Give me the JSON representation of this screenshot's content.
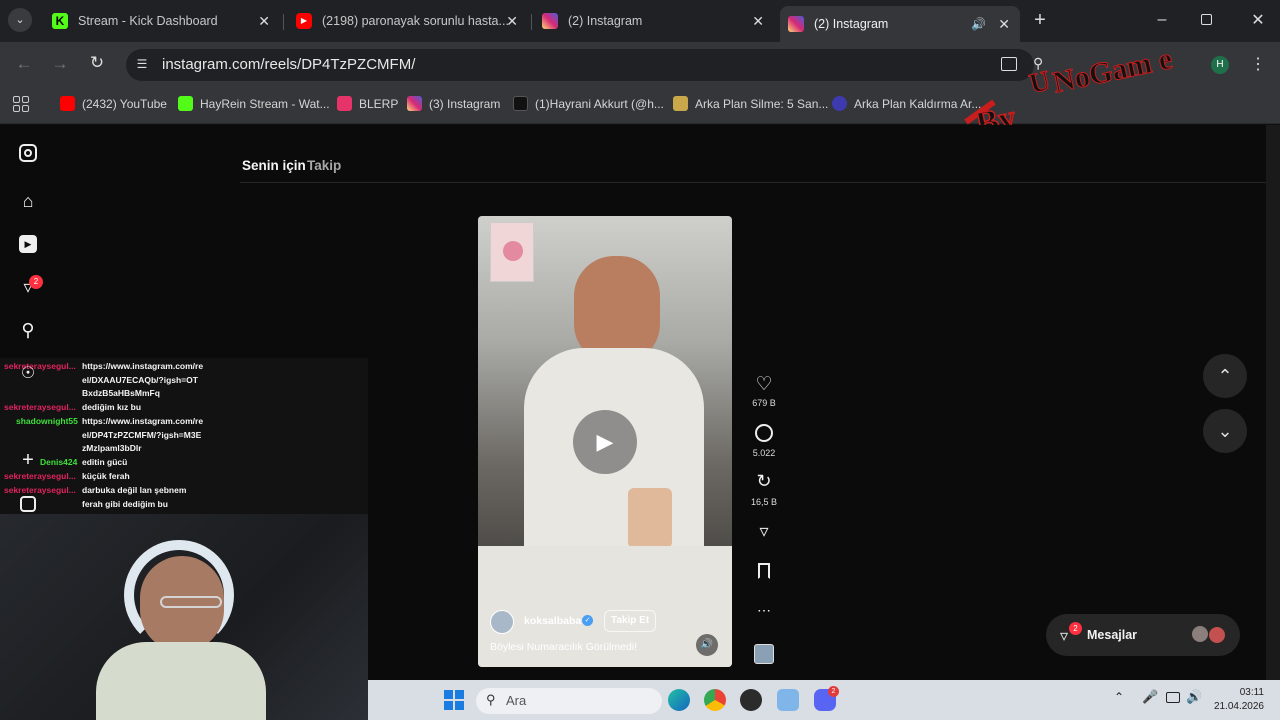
{
  "browser": {
    "tabs": [
      {
        "title": "Stream - Kick Dashboard",
        "favicon": "kick-icon",
        "color": "#53fc18"
      },
      {
        "title": "(2198) paronayak sorunlu hasta...",
        "favicon": "youtube-icon",
        "color": "#ff0000"
      },
      {
        "title": "(2) Instagram",
        "favicon": "instagram-icon",
        "color": "#d62976"
      },
      {
        "title": "(2) Instagram",
        "favicon": "instagram-icon",
        "color": "#d62976",
        "active": true
      }
    ],
    "url": "instagram.com/reels/DP4TzPZCMFM/",
    "profile_initial": "H",
    "bookmarks": [
      {
        "title": "(2432) YouTube",
        "favicon": "youtube-icon",
        "color": "#ff0000"
      },
      {
        "title": "HayRein Stream - Wat...",
        "favicon": "kick-icon",
        "color": "#53fc18"
      },
      {
        "title": "BLERP",
        "favicon": "blerp-icon",
        "color": "#e6346b"
      },
      {
        "title": "(3) Instagram",
        "favicon": "instagram-icon",
        "color": "#d62976"
      },
      {
        "title": "(1)Hayrani Akkurt (@h...",
        "favicon": "tiktok-icon",
        "color": "#111111"
      },
      {
        "title": "Arka Plan Silme: 5 San...",
        "favicon": "layers-icon",
        "color": "#c8a84a"
      },
      {
        "title": "Arka Plan Kaldırma Ar...",
        "favicon": "p-icon",
        "color": "#3d3ab0"
      }
    ]
  },
  "watermark": {
    "text_top": "NoGam e",
    "text_letter": "U",
    "text_by": "By"
  },
  "instagram": {
    "feed_tabs": [
      {
        "label": "Senin için",
        "active": true
      },
      {
        "label": "Takip",
        "active": false
      }
    ],
    "notification_badge": "2",
    "reel": {
      "username": "koksalbaba",
      "follow_label": "Takip Et",
      "caption": "Böylesi Numaracılık Görülmedi!",
      "likes": "679 B",
      "comments": "5.022",
      "reposts": "16,5 B"
    },
    "messages": {
      "label": "Mesajlar",
      "badge": "2"
    }
  },
  "chat": [
    {
      "user": "sekreteraysegul...",
      "user_color": "#e0235f",
      "msg": "https://www.instagram.com/reel/DXAAU7ECAQb/?igsh=OTBxdzB5aHBsMmFq"
    },
    {
      "user": "sekreteraysegul...",
      "user_color": "#e0235f",
      "msg": "dediğim kız bu"
    },
    {
      "user": "shadownight55",
      "user_color": "#3fe03c",
      "msg": "https://www.instagram.com/reel/DP4TzPZCMFM/?igsh=M3EzMzlpaml3bDlr"
    },
    {
      "user": "Denis424",
      "user_color": "#3fe03c",
      "msg": "editin gücü"
    },
    {
      "user": "sekreteraysegul...",
      "user_color": "#e0235f",
      "msg": "küçük ferah"
    },
    {
      "user": "sekreteraysegul...",
      "user_color": "#e0235f",
      "msg": "darbuka değil lan şebnem ferah gibi dediğim bu"
    }
  ],
  "taskbar": {
    "search_placeholder": "Ara",
    "time": "03:11",
    "date": "21.04.2026",
    "discord_badge": "2"
  }
}
